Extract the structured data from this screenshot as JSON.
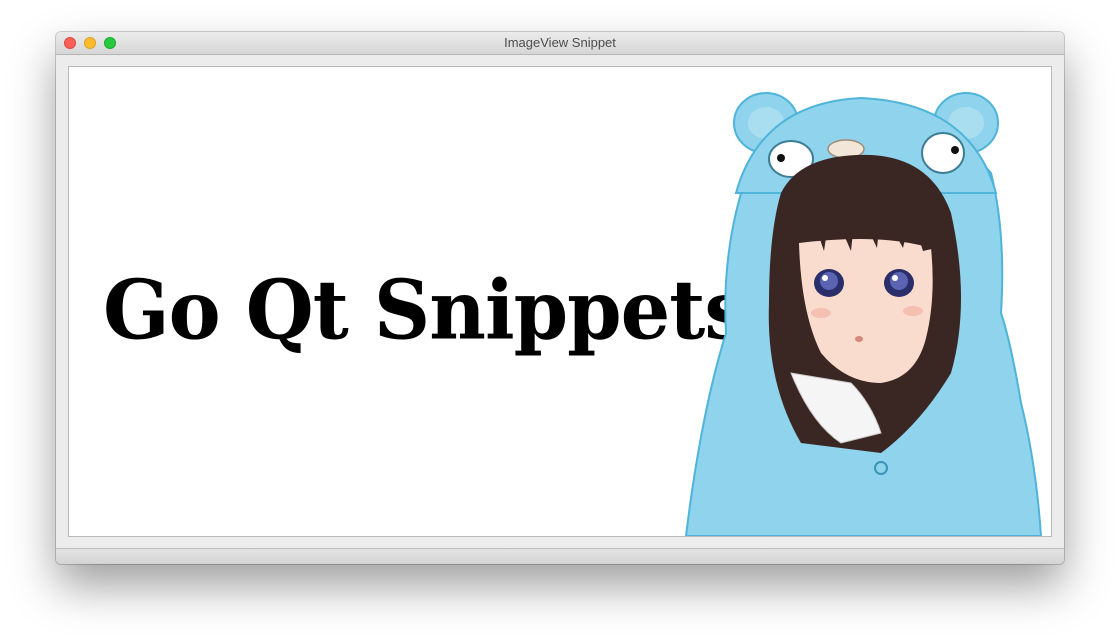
{
  "window": {
    "title": "ImageView Snippet"
  },
  "image_view": {
    "banner_text": "Go Qt Snippets",
    "illustration": "girl-in-blue-gopher-hoodie"
  },
  "colors": {
    "close": "#fc5f57",
    "minimize": "#fdbc2e",
    "zoom": "#28c840",
    "hoodie": "#8fd3ec",
    "hoodie_shadow": "#4fb4d9"
  }
}
